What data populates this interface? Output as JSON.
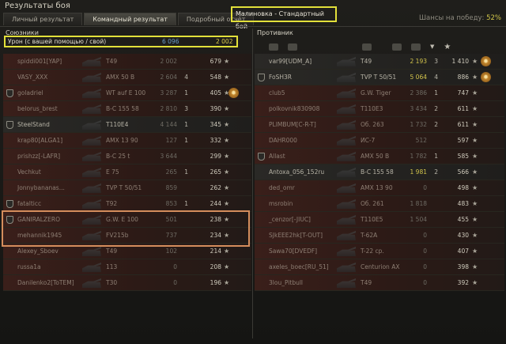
{
  "window_title": "Результаты боя",
  "tabs": [
    "Личный результат",
    "Командный результат",
    "Подробный отчёт"
  ],
  "battle_title": "Малиновка - Стандартный бой",
  "win_chance_label": "Шансы на победу:",
  "win_chance_value": "52%",
  "ally": {
    "title": "Союзники",
    "damage_label": "Урон (с вашей помощью / свой)",
    "damage_assist": "6 096",
    "damage_own": "2 002",
    "rows": [
      {
        "name": "spiddi001[YAP]",
        "tank": "T49",
        "dmg": "2 002",
        "kills": "",
        "xp": "679",
        "dead": true,
        "lamp": false,
        "medal": false
      },
      {
        "name": "VASY_XXX",
        "tank": "AMX 50 B",
        "dmg": "2 604",
        "kills": "4",
        "xp": "548",
        "dead": true,
        "lamp": false,
        "medal": false
      },
      {
        "name": "goladriel",
        "tank": "WT auf E 100",
        "dmg": "3 287",
        "kills": "1",
        "xp": "405",
        "dead": true,
        "lamp": true,
        "medal": true
      },
      {
        "name": "belorus_brest",
        "tank": "B-C 155 58",
        "dmg": "2 810",
        "kills": "3",
        "xp": "390",
        "dead": true,
        "lamp": false,
        "medal": false
      },
      {
        "name": "SteelStand",
        "tank": "T110E4",
        "dmg": "4 144",
        "kills": "1",
        "xp": "345",
        "dead": false,
        "lamp": true,
        "medal": false
      },
      {
        "name": "krap80[ALGA1]",
        "tank": "AMX 13 90",
        "dmg": "127",
        "kills": "1",
        "xp": "332",
        "dead": true,
        "lamp": false,
        "medal": false
      },
      {
        "name": "prishzz[-LAFR]",
        "tank": "B-C 25 t",
        "dmg": "3 644",
        "kills": "",
        "xp": "299",
        "dead": true,
        "lamp": false,
        "medal": false
      },
      {
        "name": "Vechkut",
        "tank": "E 75",
        "dmg": "265",
        "kills": "1",
        "xp": "265",
        "dead": true,
        "lamp": false,
        "medal": false
      },
      {
        "name": "Jonnybananas...",
        "tank": "TVP T 50/51",
        "dmg": "859",
        "kills": "",
        "xp": "262",
        "dead": true,
        "lamp": false,
        "medal": false
      },
      {
        "name": "fatalticc",
        "tank": "T92",
        "dmg": "853",
        "kills": "1",
        "xp": "244",
        "dead": true,
        "lamp": true,
        "medal": false
      },
      {
        "name": "GANIRALZERO",
        "tank": "G.W. E 100",
        "dmg": "501",
        "kills": "",
        "xp": "238",
        "dead": true,
        "lamp": true,
        "medal": false
      },
      {
        "name": "mehannik1945",
        "tank": "FV215b",
        "dmg": "737",
        "kills": "",
        "xp": "234",
        "dead": true,
        "lamp": false,
        "medal": false
      },
      {
        "name": "Alexey_Sboev",
        "tank": "T49",
        "dmg": "102",
        "kills": "",
        "xp": "214",
        "dead": true,
        "lamp": false,
        "medal": false
      },
      {
        "name": "russa1a",
        "tank": "113",
        "dmg": "0",
        "kills": "",
        "xp": "208",
        "dead": true,
        "lamp": false,
        "medal": false
      },
      {
        "name": "Danilenko2[ToTEM]",
        "tank": "T30",
        "dmg": "0",
        "kills": "",
        "xp": "196",
        "dead": true,
        "lamp": false,
        "medal": false
      }
    ]
  },
  "enemy": {
    "title": "Противник",
    "rows": [
      {
        "name": "var99[UDM_A]",
        "tank": "T49",
        "dmg": "2 193",
        "kills": "3",
        "xp": "1 410",
        "dead": false,
        "lamp": false,
        "medal": true,
        "hi": true
      },
      {
        "name": "FoSH3R",
        "tank": "TVP T 50/51",
        "dmg": "5 064",
        "kills": "4",
        "xp": "886",
        "dead": false,
        "lamp": true,
        "medal": true,
        "hi": true
      },
      {
        "name": "club5",
        "tank": "G.W. Tiger",
        "dmg": "2 386",
        "kills": "1",
        "xp": "747",
        "dead": true,
        "lamp": false,
        "medal": false,
        "hi": false
      },
      {
        "name": "polkovnik830908",
        "tank": "T110E3",
        "dmg": "3 434",
        "kills": "2",
        "xp": "611",
        "dead": true,
        "lamp": false,
        "medal": false,
        "hi": false
      },
      {
        "name": "PLIMBUM[C-R-T]",
        "tank": "Об. 263",
        "dmg": "1 732",
        "kills": "2",
        "xp": "611",
        "dead": true,
        "lamp": false,
        "medal": false,
        "hi": false
      },
      {
        "name": "DAHR000",
        "tank": "ИС-7",
        "dmg": "512",
        "kills": "",
        "xp": "597",
        "dead": true,
        "lamp": false,
        "medal": false,
        "hi": false
      },
      {
        "name": "Allast",
        "tank": "AMX 50 B",
        "dmg": "1 782",
        "kills": "1",
        "xp": "585",
        "dead": true,
        "lamp": true,
        "medal": false,
        "hi": false
      },
      {
        "name": "Antoxa_056_152ru",
        "tank": "B-C 155 58",
        "dmg": "1 981",
        "kills": "2",
        "xp": "566",
        "dead": false,
        "lamp": false,
        "medal": false,
        "hi": true
      },
      {
        "name": "ded_omr",
        "tank": "AMX 13 90",
        "dmg": "0",
        "kills": "",
        "xp": "498",
        "dead": true,
        "lamp": false,
        "medal": false,
        "hi": false
      },
      {
        "name": "msrobin",
        "tank": "Об. 261",
        "dmg": "1 818",
        "kills": "",
        "xp": "483",
        "dead": true,
        "lamp": false,
        "medal": false,
        "hi": false
      },
      {
        "name": "_cenzor[-JIUC]",
        "tank": "T110E5",
        "dmg": "1 504",
        "kills": "",
        "xp": "455",
        "dead": true,
        "lamp": false,
        "medal": false,
        "hi": false
      },
      {
        "name": "SJkEEE2hk[T-OUT]",
        "tank": "T-62A",
        "dmg": "0",
        "kills": "",
        "xp": "430",
        "dead": true,
        "lamp": false,
        "medal": false,
        "hi": false
      },
      {
        "name": "Sawa70[DVEDF]",
        "tank": "T-22 ср.",
        "dmg": "0",
        "kills": "",
        "xp": "407",
        "dead": true,
        "lamp": false,
        "medal": false,
        "hi": false
      },
      {
        "name": "axeles_boec[RU_51]",
        "tank": "Centurion AX",
        "dmg": "0",
        "kills": "",
        "xp": "398",
        "dead": true,
        "lamp": false,
        "medal": false,
        "hi": false
      },
      {
        "name": "3lou_Pitbull",
        "tank": "T49",
        "dmg": "0",
        "kills": "",
        "xp": "392",
        "dead": true,
        "lamp": false,
        "medal": false,
        "hi": false
      }
    ]
  },
  "icons": {
    "star": "★",
    "medal": "✹",
    "chevron": "▼"
  }
}
